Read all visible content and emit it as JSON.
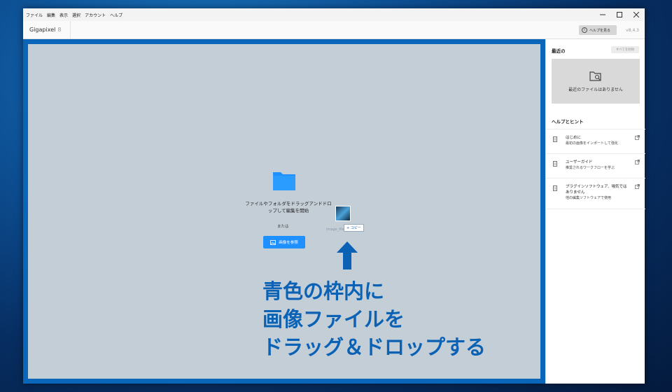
{
  "menu": [
    "ファイル",
    "編集",
    "表示",
    "選択",
    "アカウント",
    "ヘルプ"
  ],
  "toolbar": {
    "app_name": "Gigapixel",
    "app_version": "8",
    "help_label": "ヘルプを見る",
    "version": "v8.4.3"
  },
  "dropzone": {
    "title": "ファイルやフォルダをドラッグアンドドロップして編集を開始",
    "or": "または",
    "browse_label": "画像を参照"
  },
  "drag": {
    "file_name": "image_file.jpg",
    "copy_badge": "+ コピー"
  },
  "instruction": {
    "line1": "青色の枠内に",
    "line2": "画像ファイルを",
    "line3": "ドラッグ＆ドロップする"
  },
  "right_panel": {
    "recent_title": "最近の",
    "clear_all": "すべてを削除",
    "no_recent": "最近のファイルはありません",
    "help_title": "ヘルプとヒント",
    "hints": [
      {
        "title": "はじめに",
        "desc": "最初の画像をインポートして強化"
      },
      {
        "title": "ユーザーガイド",
        "desc": "推奨されるワークフローを学ぶ"
      },
      {
        "title": "プラグインソフトウェア、場気ではありません",
        "desc": "他の編集ソフトウェアで使用"
      }
    ]
  },
  "colors": {
    "frame_blue": "#0a66b8",
    "instruction_blue": "#0b62b5",
    "browse_button": "#1e90ff",
    "folder_blue": "#1e90ff"
  }
}
